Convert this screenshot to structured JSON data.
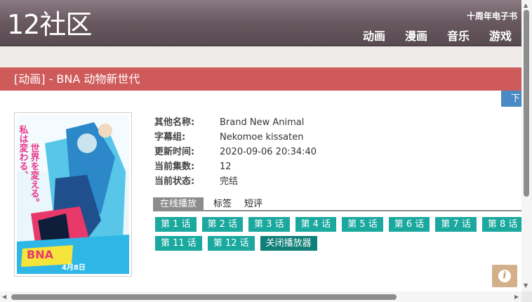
{
  "header": {
    "logo": "12社区",
    "top_link": "十周年电子书",
    "nav": [
      "动画",
      "漫画",
      "音乐",
      "游戏"
    ]
  },
  "title_bar": "[动画] - BNA 动物新世代",
  "next_button": "下",
  "info": {
    "rows": [
      {
        "label": "其他名称:",
        "value": "Brand New Animal"
      },
      {
        "label": "字幕组:",
        "value": "Nekomoe kissaten"
      },
      {
        "label": "更新时间:",
        "value": "2020-09-06 20:34:40"
      },
      {
        "label": "当前集数:",
        "value": "12"
      },
      {
        "label": "当前状态:",
        "value": "完结"
      }
    ]
  },
  "tabs": [
    "在线播放",
    "标签",
    "短评"
  ],
  "episodes": [
    "第 1 话",
    "第 2 话",
    "第 3 话",
    "第 4 话",
    "第 5 话",
    "第 6 话",
    "第 7 话",
    "第 8 话",
    "第 11 话",
    "第 12 话"
  ],
  "close_player": "关闭播放器",
  "poster": {
    "vertical_text": [
      "私は変わる、",
      "世界を変える。"
    ],
    "date_text": "4月8日"
  },
  "colors": {
    "header": "#6a5a61",
    "title_bar": "#cf5a5a",
    "episode": "#1aa89f",
    "next_button": "#4a8ac4"
  }
}
